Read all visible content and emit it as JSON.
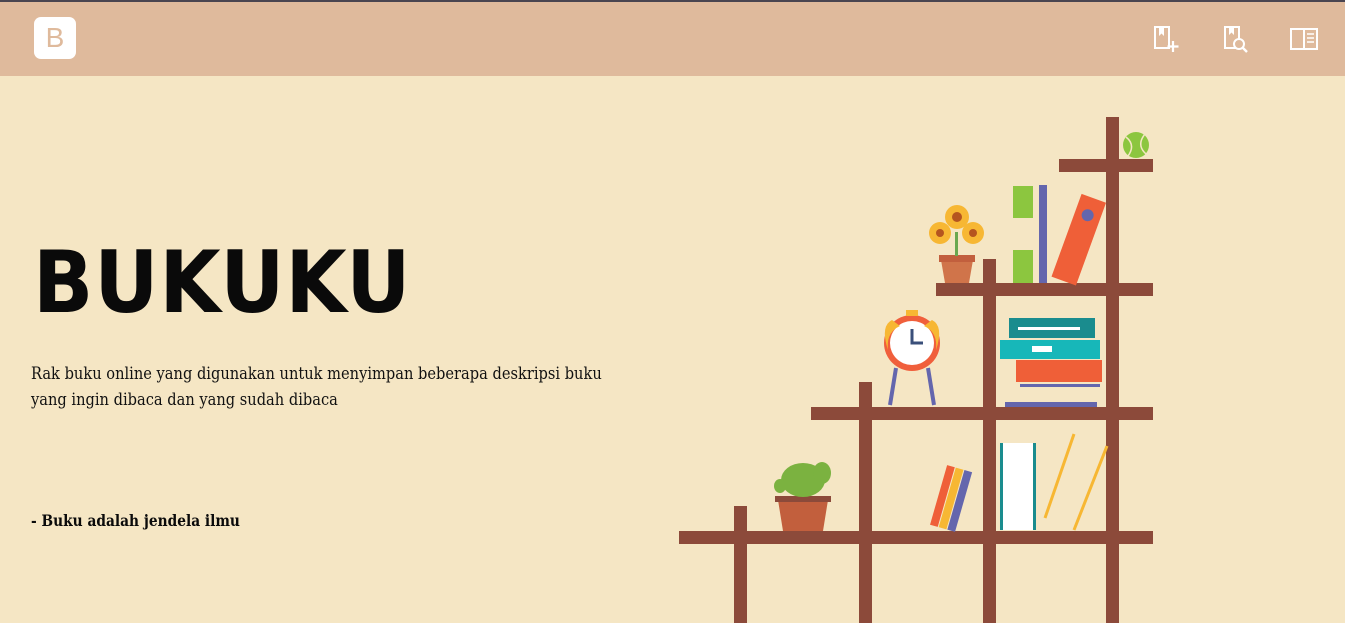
{
  "navbar": {
    "brand_letter": "B",
    "icons": [
      "bookmark-add-icon",
      "book-search-icon",
      "sidebar-panel-icon"
    ]
  },
  "hero": {
    "title": "BUKUKU",
    "description": "Rak buku online yang digunakan untuk menyimpan beberapa deskripsi buku yang ingin dibaca dan yang sudah dibaca",
    "quote": "- Buku adalah jendela ilmu"
  },
  "colors": {
    "navbar": "#dfba9c",
    "background": "#f5e6c4",
    "shelf": "#8c4a3a"
  }
}
